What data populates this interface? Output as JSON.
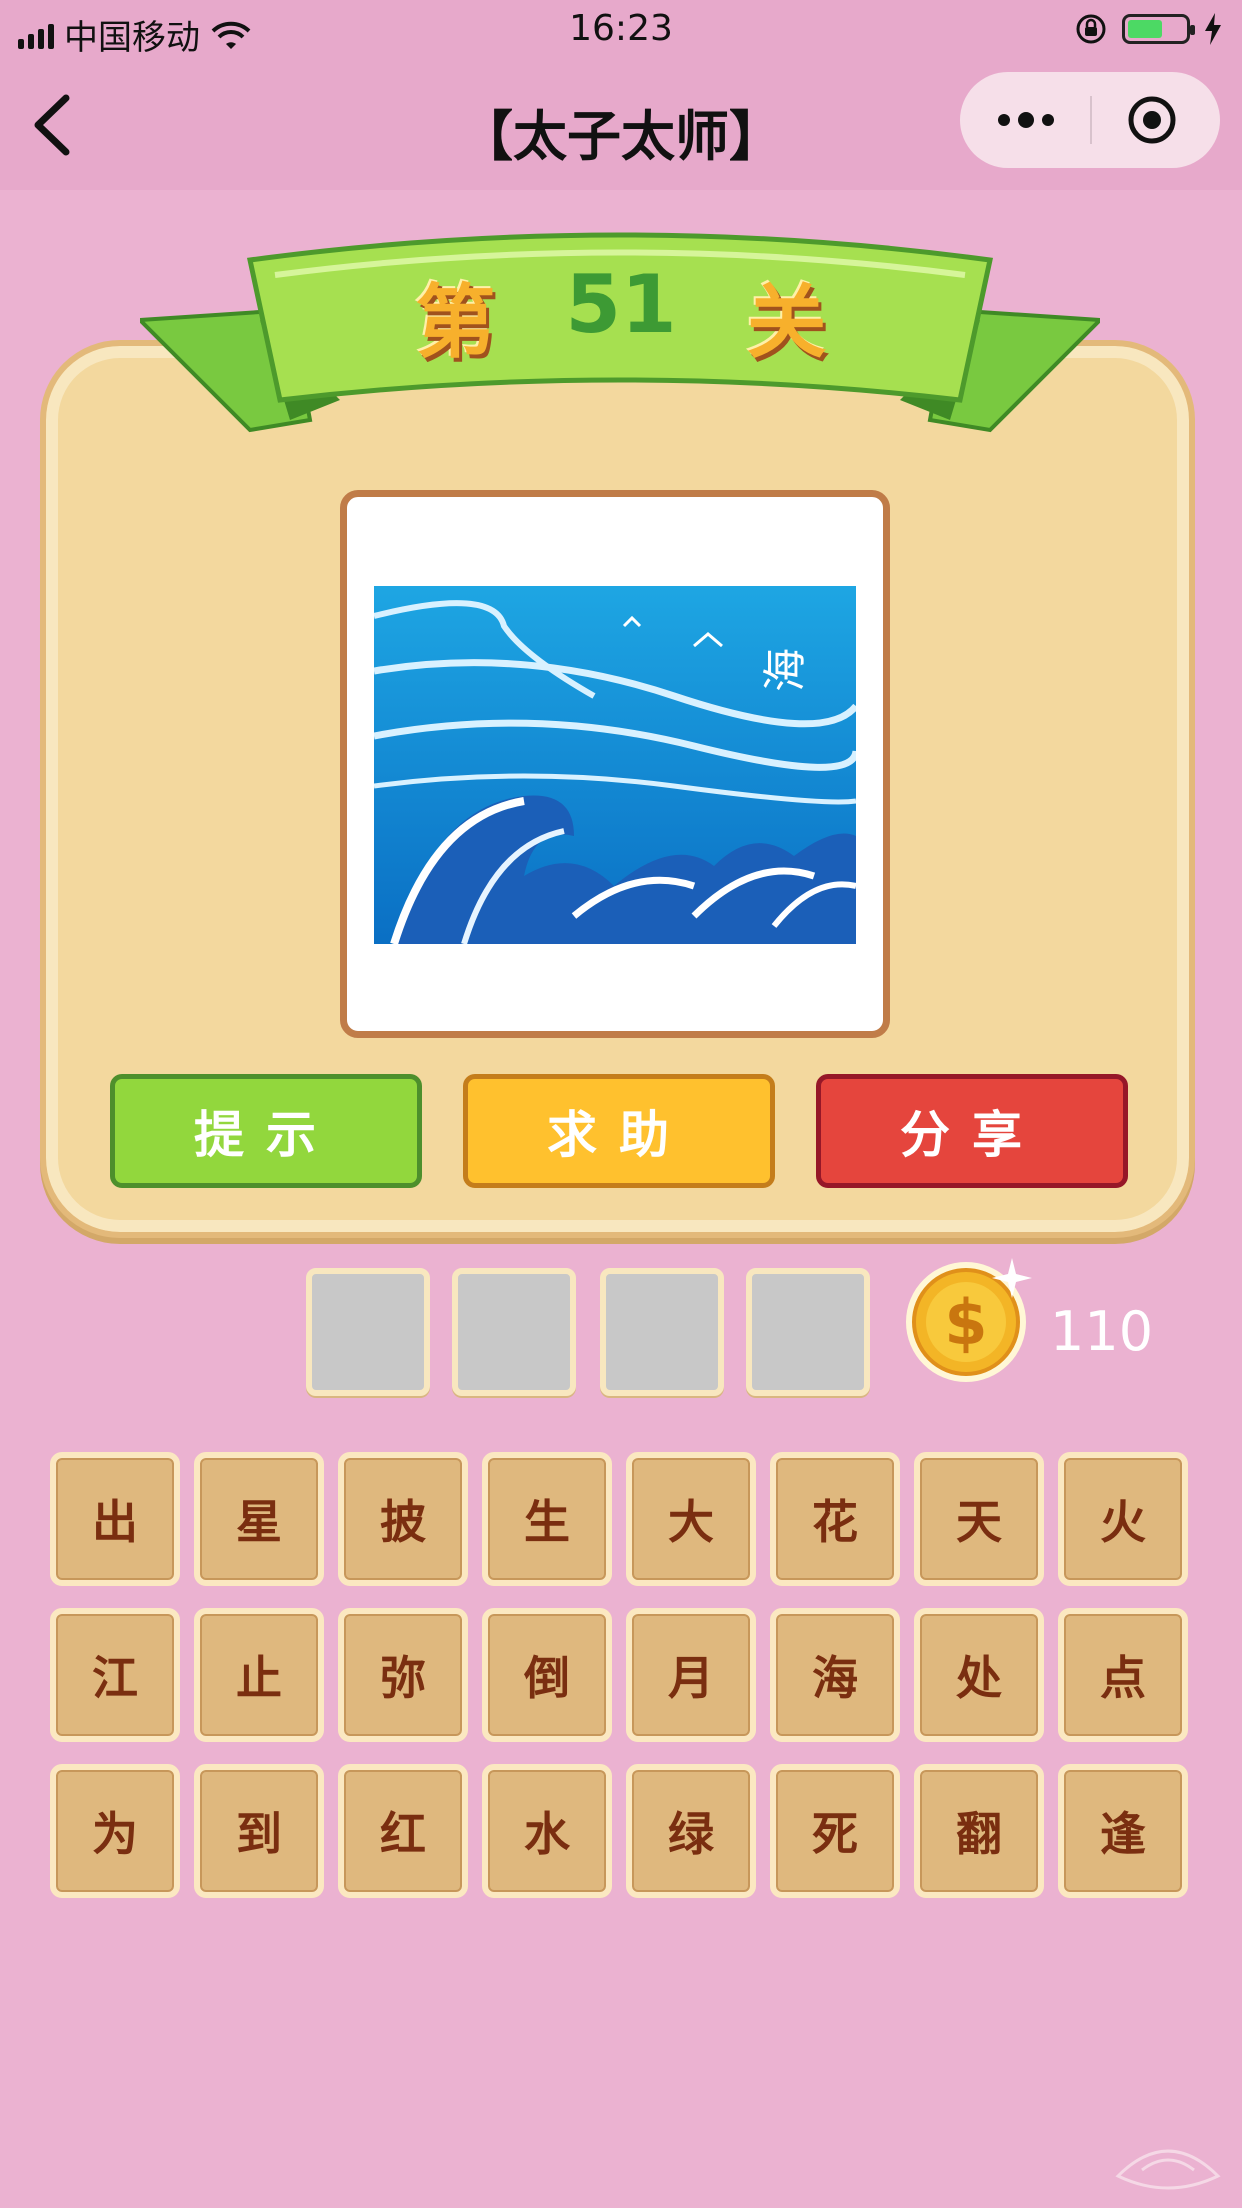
{
  "status": {
    "carrier": "中国移动",
    "time": "16:23"
  },
  "nav": {
    "title": "【太子太师】"
  },
  "level": {
    "prefix": "第",
    "number": "51",
    "suffix": "关"
  },
  "buttons": {
    "hint": "提示",
    "help": "求助",
    "share": "分享"
  },
  "answer_slots": [
    "",
    "",
    "",
    ""
  ],
  "coins": "110",
  "characters": [
    [
      "出",
      "星",
      "披",
      "生",
      "大",
      "花",
      "天",
      "火"
    ],
    [
      "江",
      "止",
      "弥",
      "倒",
      "月",
      "海",
      "处",
      "点"
    ],
    [
      "为",
      "到",
      "红",
      "水",
      "绿",
      "死",
      "翻",
      "逢"
    ]
  ],
  "puzzle_image": {
    "caption_glyph": "海"
  },
  "colors": {
    "background": "#ebb2d1",
    "hint": "#92d73d",
    "help": "#ffc12e",
    "share": "#e5453d",
    "tile": "#dfb87e"
  }
}
